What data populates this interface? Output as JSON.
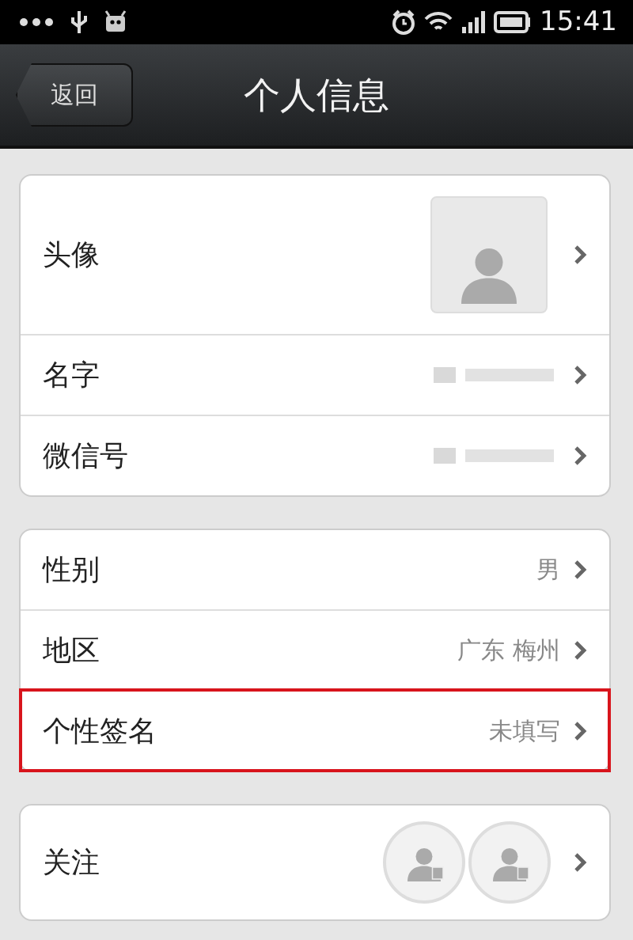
{
  "status_bar": {
    "time": "15:41"
  },
  "header": {
    "back": "返回",
    "title": "个人信息"
  },
  "groups": [
    {
      "rows": [
        {
          "kind": "avatar",
          "label": "头像",
          "highlighted": false
        },
        {
          "kind": "redacted",
          "label": "名字",
          "highlighted": false
        },
        {
          "kind": "redacted",
          "label": "微信号",
          "highlighted": false
        }
      ]
    },
    {
      "rows": [
        {
          "kind": "text",
          "label": "性别",
          "value": "男",
          "highlighted": false
        },
        {
          "kind": "text",
          "label": "地区",
          "value": "广东 梅州",
          "highlighted": false
        },
        {
          "kind": "text",
          "label": "个性签名",
          "value": "未填写",
          "highlighted": true
        }
      ]
    },
    {
      "rows": [
        {
          "kind": "follow",
          "label": "关注",
          "highlighted": false
        }
      ]
    }
  ]
}
